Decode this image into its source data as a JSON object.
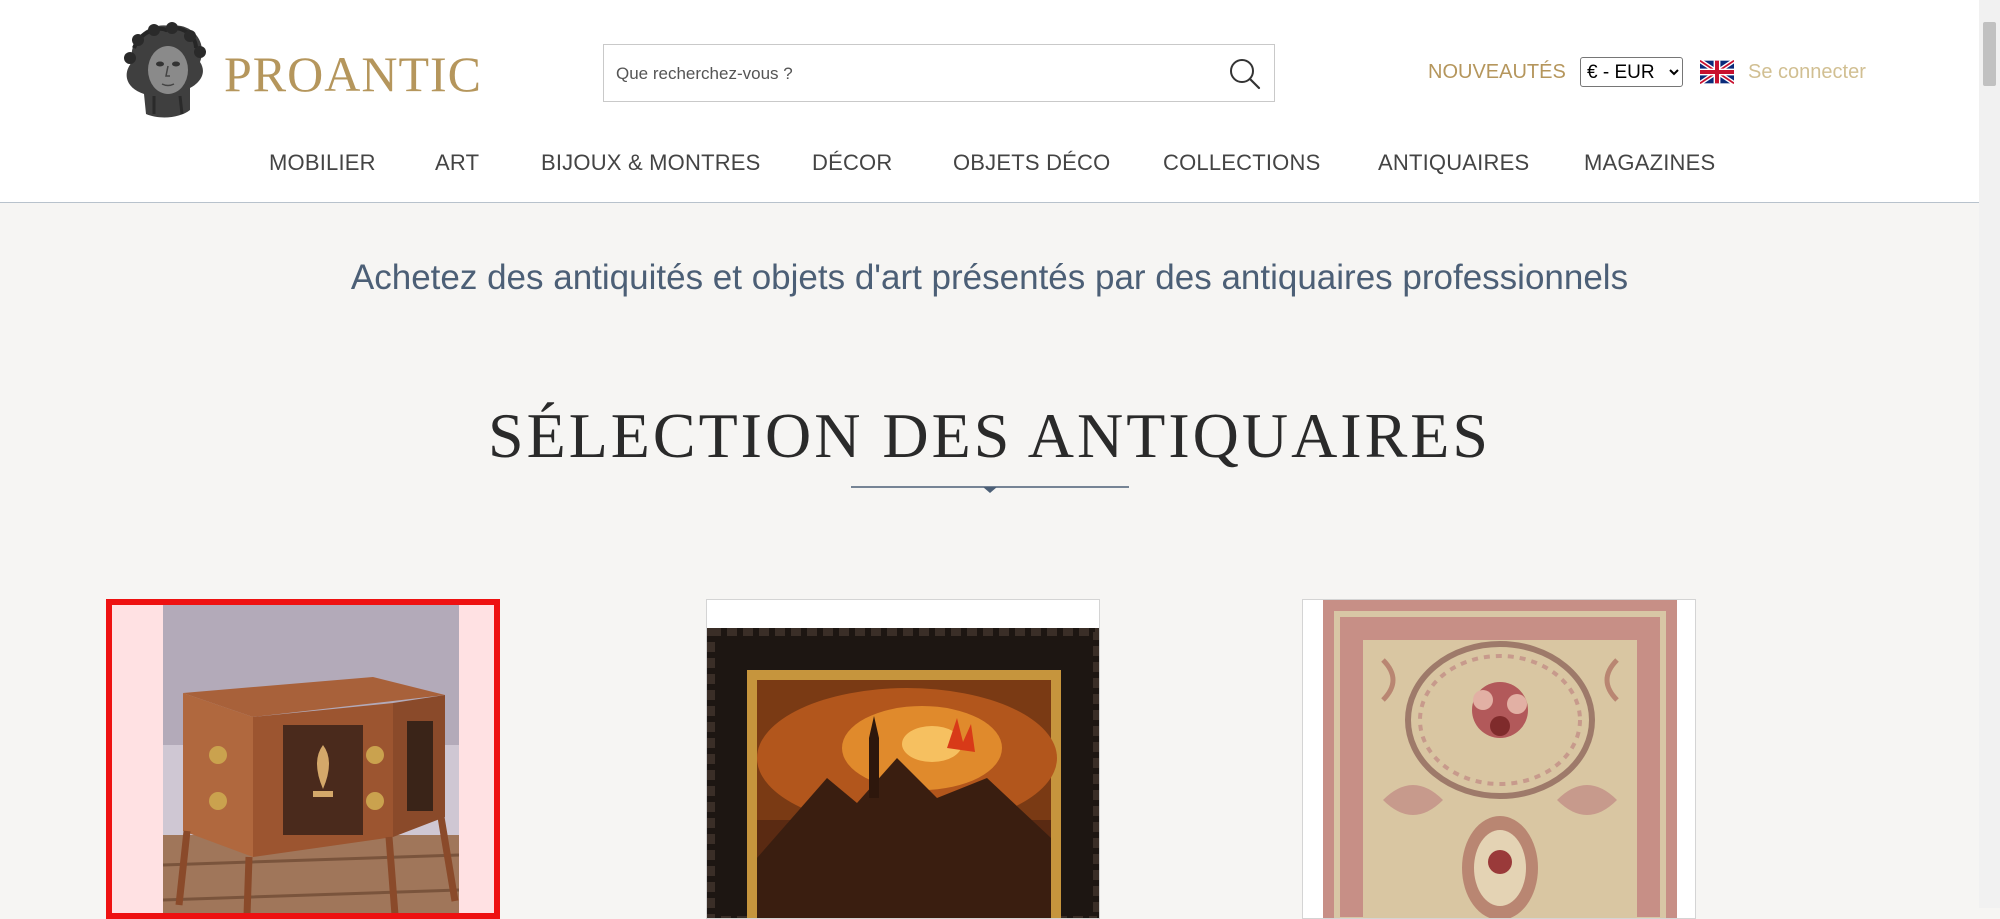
{
  "header": {
    "logo_text": "PROANTIC",
    "search": {
      "placeholder": "Que recherchez-vous ?",
      "value": ""
    },
    "new_link": "NOUVEAUTÉS",
    "currency": {
      "selected": "€ - EUR",
      "options": [
        "€ - EUR"
      ]
    },
    "language_flag": "uk-flag-icon",
    "login": "Se connecter"
  },
  "nav": {
    "items": [
      {
        "label": "MOBILIER"
      },
      {
        "label": "ART"
      },
      {
        "label": "BIJOUX & MONTRES"
      },
      {
        "label": "DÉCOR"
      },
      {
        "label": "OBJETS DÉCO"
      },
      {
        "label": "COLLECTIONS"
      },
      {
        "label": "ANTIQUAIRES"
      },
      {
        "label": "MAGAZINES"
      }
    ]
  },
  "main": {
    "tagline": "Achetez des antiquités et objets d'art présentés par des antiquaires professionnels",
    "section_title": "SÉLECTION DES ANTIQUAIRES",
    "cards": [
      {
        "image": "marquetry-commode-image",
        "selected": true
      },
      {
        "image": "night-fire-painting-image",
        "selected": false
      },
      {
        "image": "aubusson-rug-image",
        "selected": false
      }
    ]
  },
  "colors": {
    "brand_gold": "#b5965c",
    "nav_text": "#444444",
    "tagline": "#4c5f76",
    "background": "#f6f5f3",
    "selection_highlight": "#ee1111"
  }
}
